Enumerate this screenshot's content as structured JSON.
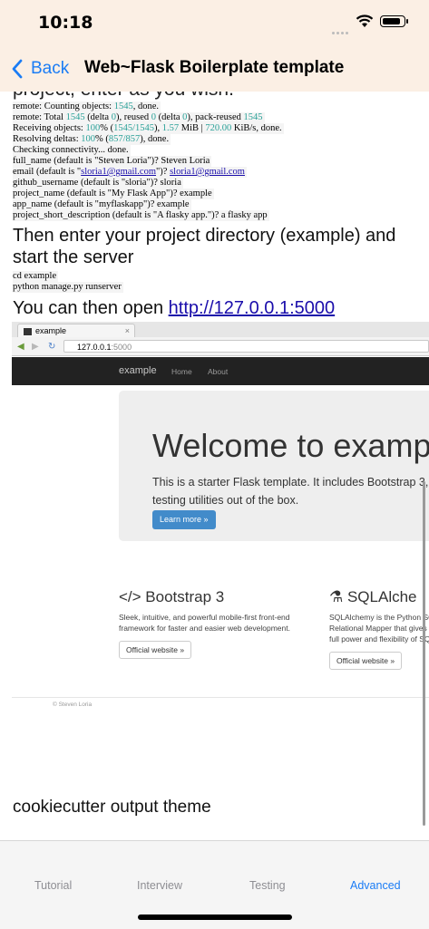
{
  "status": {
    "time": "10:18"
  },
  "nav": {
    "back": "Back",
    "title": "Web~Flask Boilerplate template"
  },
  "content": {
    "partial_heading": "project, enter as you wish.",
    "terminal": {
      "line1": [
        "remote: Counting objects: ",
        "1545",
        ", done."
      ],
      "line2": [
        "remote: Total ",
        "1545",
        " (delta ",
        "0",
        "), reused ",
        "0",
        " (delta ",
        "0",
        "), pack-reused ",
        "1545"
      ],
      "line3": [
        "Receiving objects: ",
        "100",
        "% (",
        "1545/1545",
        "), ",
        "1.57",
        " MiB | ",
        "720.00",
        " KiB/s, done."
      ],
      "line4": [
        "Resolving deltas: ",
        "100",
        "% (",
        "857/857",
        "), done."
      ],
      "line5": "Checking connectivity... done.",
      "line6": "full_name (default is \"Steven Loria\")? Steven Loria",
      "line7": {
        "pre": "email (default is \"",
        "link1": "sloria1@gmail.com",
        "mid": "\")? ",
        "link2": "sloria1@gmail.com"
      },
      "line8": "github_username (default is \"sloria\")?  sloria",
      "line9": "project_name (default is \"My Flask App\")? example",
      "line10": "app_name (default is \"myflaskapp\")? example",
      "line11": "project_short_description (default is \"A flasky app.\")? a flasky app"
    },
    "heading_server": "Then enter your project directory (example) and start the server",
    "server_cmds": [
      "cd example",
      "python manage.py runserver"
    ],
    "open_text": "You can then open ",
    "open_link": "http://127.0.0.1:5000",
    "screenshot": {
      "tab_title": "example",
      "tab_close": "×",
      "url_host": "127.0.0.1",
      "url_port": ":5000",
      "brand": "example",
      "nav_home": "Home",
      "nav_about": "About",
      "jumbo_title": "Welcome to examp",
      "jumbo_line1": "This is a starter Flask template. It includes Bootstrap 3,",
      "jumbo_line2": "testing utilities out of the box.",
      "learn_more": "Learn more »",
      "col1_title": "</> Bootstrap 3",
      "col1_line1": "Sleek, intuitive, and powerful mobile-first front-end",
      "col1_line2": "framework for faster and easier web development.",
      "col1_button": "Official website »",
      "col2_title": "SQLAlche",
      "col2_line1": "SQLAlchemy is the Python SQ",
      "col2_line2": "Relational Mapper that gives",
      "col2_line3": "full power and flexibility of SQ",
      "col2_button": "Official website »",
      "footer": "© Steven Loria"
    },
    "caption": "cookiecutter output theme"
  },
  "tabs": [
    {
      "label": "Tutorial"
    },
    {
      "label": "Interview"
    },
    {
      "label": "Testing"
    },
    {
      "label": "Advanced"
    }
  ],
  "colors": {
    "accent": "#1a7cf5",
    "teal": "#2aa198",
    "header_bg": "#fbefe4"
  }
}
